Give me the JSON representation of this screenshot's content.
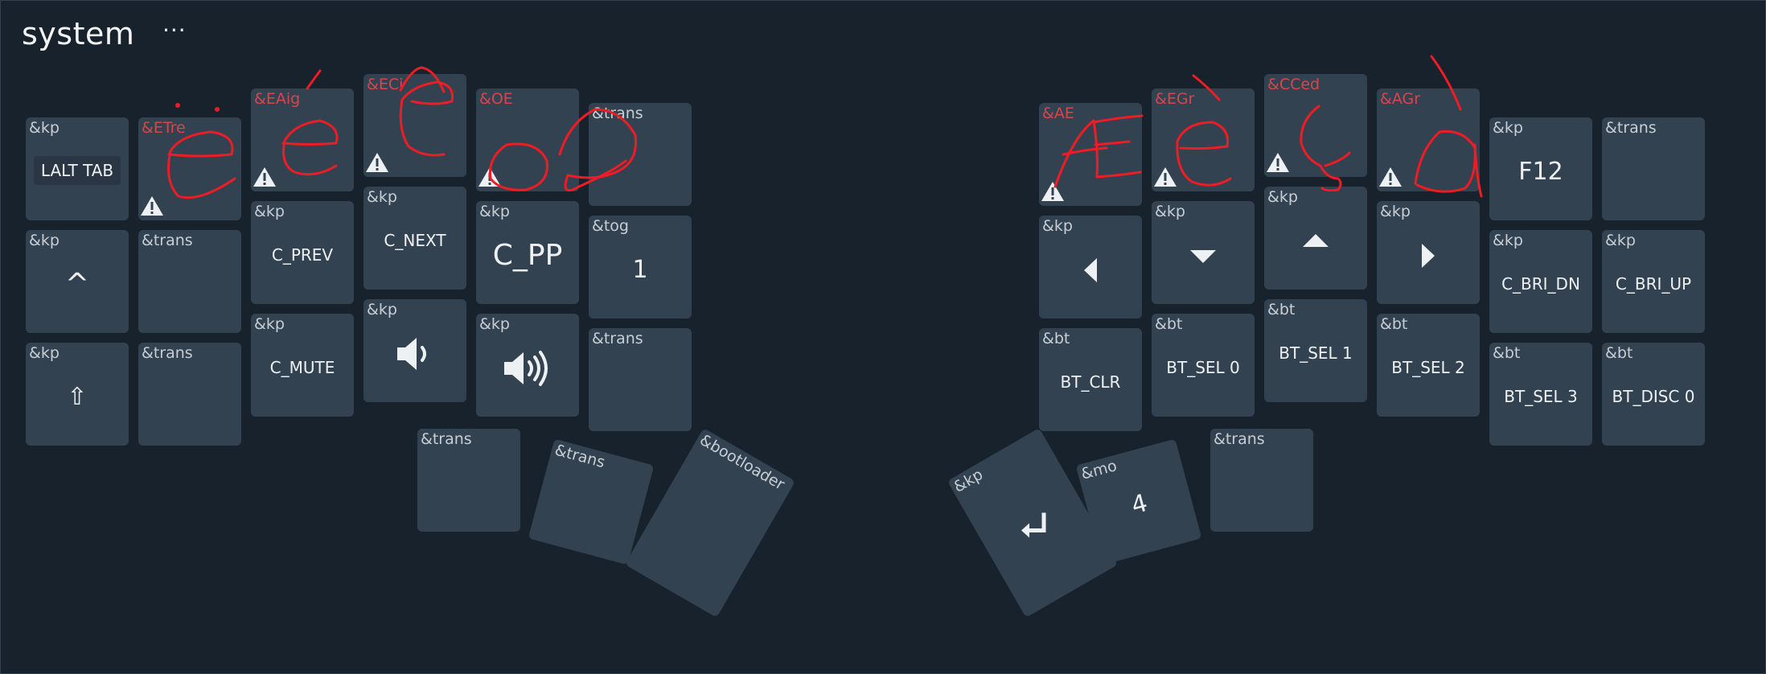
{
  "layer": {
    "title": "system",
    "menu": "···"
  },
  "left": {
    "row1": [
      {
        "behavior": "&kp",
        "param": "LALT  TAB"
      },
      {
        "behavior": "&ETre"
      },
      {
        "behavior": "&EAig"
      },
      {
        "behavior": "&ECi"
      },
      {
        "behavior": "&OE"
      },
      {
        "behavior": "&trans"
      }
    ],
    "row2": [
      {
        "behavior": "&kp",
        "param": "^"
      },
      {
        "behavior": "&trans"
      },
      {
        "behavior": "&kp",
        "param": "C_PREV"
      },
      {
        "behavior": "&kp",
        "param": "C_NEXT"
      },
      {
        "behavior": "&kp",
        "param": "C_PP"
      },
      {
        "behavior": "&tog",
        "param": "1"
      }
    ],
    "row3": [
      {
        "behavior": "&kp",
        "param": "⇧"
      },
      {
        "behavior": "&trans"
      },
      {
        "behavior": "&kp",
        "param": "C_MUTE"
      },
      {
        "behavior": "&kp",
        "icon": "volume-down-icon"
      },
      {
        "behavior": "&kp",
        "icon": "volume-up-icon"
      },
      {
        "behavior": "&trans"
      }
    ],
    "thumbs": [
      {
        "behavior": "&trans"
      },
      {
        "behavior": "&trans"
      },
      {
        "behavior": "&bootloader"
      }
    ]
  },
  "right": {
    "row1": [
      {
        "behavior": "&AE"
      },
      {
        "behavior": "&EGr"
      },
      {
        "behavior": "&CCed"
      },
      {
        "behavior": "&AGr"
      },
      {
        "behavior": "&kp",
        "param": "F12"
      },
      {
        "behavior": "&trans"
      }
    ],
    "row2": [
      {
        "behavior": "&kp",
        "icon": "arrow-left-icon"
      },
      {
        "behavior": "&kp",
        "icon": "arrow-down-icon"
      },
      {
        "behavior": "&kp",
        "icon": "arrow-up-icon"
      },
      {
        "behavior": "&kp",
        "icon": "arrow-right-icon"
      },
      {
        "behavior": "&kp",
        "param": "C_BRI_DN"
      },
      {
        "behavior": "&kp",
        "param": "C_BRI_UP"
      }
    ],
    "row3": [
      {
        "behavior": "&bt",
        "param": "BT_CLR"
      },
      {
        "behavior": "&bt",
        "param": "BT_SEL 0"
      },
      {
        "behavior": "&bt",
        "param": "BT_SEL 1"
      },
      {
        "behavior": "&bt",
        "param": "BT_SEL 2"
      },
      {
        "behavior": "&bt",
        "param": "BT_SEL 3"
      },
      {
        "behavior": "&bt",
        "param": "BT_DISC 0"
      }
    ],
    "thumbs": [
      {
        "behavior": "&kp",
        "icon": "return-enter-icon"
      },
      {
        "behavior": "&mo",
        "param": "4"
      },
      {
        "behavior": "&trans"
      }
    ]
  },
  "colors": {
    "background": "#18222c",
    "key": "#334250",
    "warning_behavior": "#d8454a",
    "annotation": "#ee1c24"
  }
}
